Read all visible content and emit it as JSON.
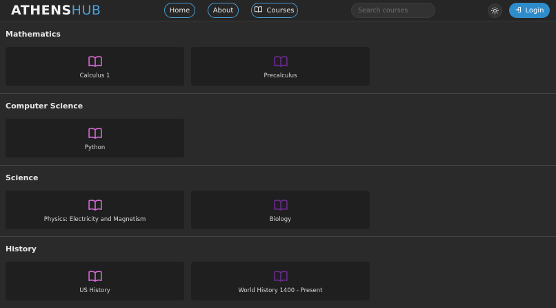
{
  "header": {
    "logo_part1": "ATHENS",
    "logo_part2": "HUB",
    "nav": [
      "Home",
      "About",
      "Courses"
    ],
    "search_placeholder": "Search courses",
    "login_label": "Login"
  },
  "colors": {
    "accent": "#2f8ccb",
    "book_icon_active": "#d46ad4",
    "book_icon_dim": "#6a2a8e"
  },
  "sections": [
    {
      "title": "Mathematics",
      "courses": [
        "Calculus 1",
        "Precalculus"
      ]
    },
    {
      "title": "Computer Science",
      "courses": [
        "Python"
      ]
    },
    {
      "title": "Science",
      "courses": [
        "Physics: Electricity and Magnetism",
        "Biology"
      ]
    },
    {
      "title": "History",
      "courses": [
        "US History",
        "World History 1400 - Present"
      ]
    }
  ]
}
